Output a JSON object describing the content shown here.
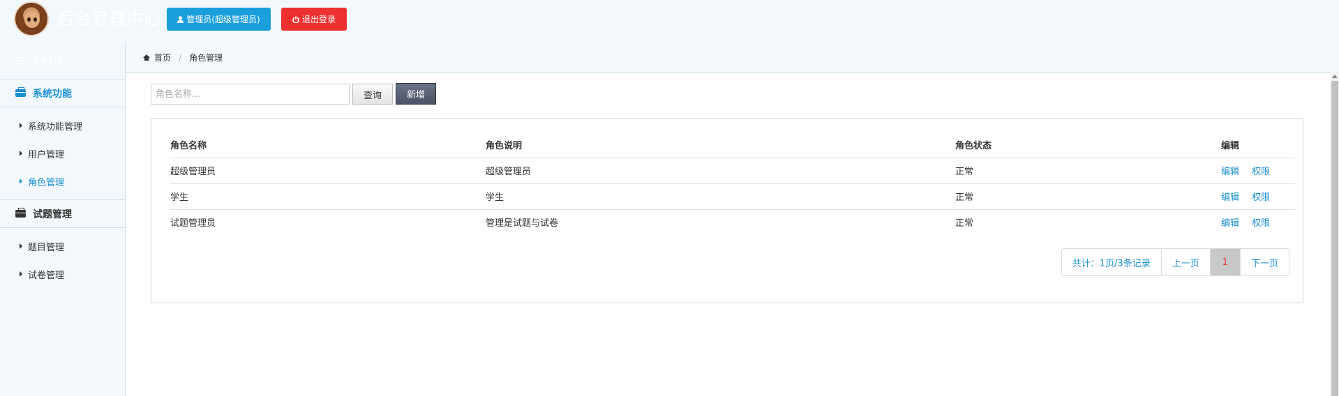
{
  "header": {
    "title": "后台管理中心",
    "admin_button": "管理员(超级管理员)",
    "logout_button": "退出登录"
  },
  "sidebar": {
    "heading": "菜单列表",
    "groups": [
      {
        "label": "系统功能",
        "active": true,
        "items": [
          {
            "label": "系统功能管理",
            "active": false
          },
          {
            "label": "用户管理",
            "active": false
          },
          {
            "label": "角色管理",
            "active": true
          }
        ]
      },
      {
        "label": "试题管理",
        "active": false,
        "items": [
          {
            "label": "题目管理",
            "active": false
          },
          {
            "label": "试卷管理",
            "active": false
          }
        ]
      }
    ]
  },
  "breadcrumb": {
    "home": "首页",
    "current": "角色管理"
  },
  "toolbar": {
    "search_placeholder": "角色名称...",
    "search_value": "",
    "query_button": "查询",
    "add_button": "新增"
  },
  "table": {
    "headers": [
      "角色名称",
      "角色说明",
      "角色状态",
      "编辑"
    ],
    "rows": [
      {
        "name": "超级管理员",
        "desc": "超级管理员",
        "status": "正常",
        "edit": "编辑",
        "perm": "权限"
      },
      {
        "name": "学生",
        "desc": "学生",
        "status": "正常",
        "edit": "编辑",
        "perm": "权限"
      },
      {
        "name": "试题管理员",
        "desc": "管理是试题与试卷",
        "status": "正常",
        "edit": "编辑",
        "perm": "权限"
      }
    ]
  },
  "pagination": {
    "summary": "共计：1页/3条记录",
    "prev": "上一页",
    "current": "1",
    "next": "下一页"
  },
  "colors": {
    "primary": "#1a9fdd",
    "danger": "#ed3131",
    "link": "#1a8fd0",
    "add_button": "#4a5366"
  }
}
